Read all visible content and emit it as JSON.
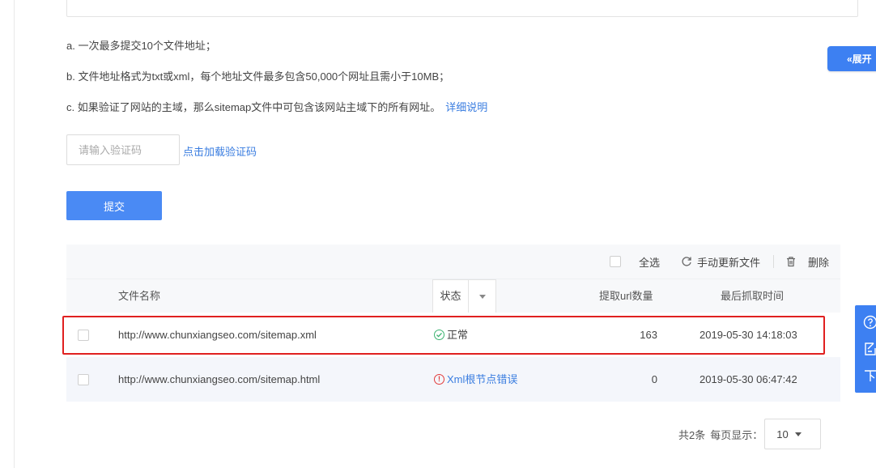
{
  "notes": {
    "a": "a. 一次最多提交10个文件地址；",
    "b": "b. 文件地址格式为txt或xml，每个地址文件最多包含50,000个网址且需小于10MB；",
    "c": "c. 如果验证了网站的主域，那么sitemap文件中可包含该网站主域下的所有网址。",
    "c_link": "详细说明"
  },
  "captcha": {
    "placeholder": "请输入验证码",
    "load_link": "点击加载验证码"
  },
  "submit_label": "提交",
  "toolbar": {
    "select_all": "全选",
    "refresh": "手动更新文件",
    "delete": "删除"
  },
  "table": {
    "headers": {
      "filename": "文件名称",
      "status": "状态",
      "url_count": "提取url数量",
      "last_fetch": "最后抓取时间"
    },
    "rows": [
      {
        "filename": "http://www.chunxiangseo.com/sitemap.xml",
        "status": "正常",
        "status_type": "ok",
        "url_count": "163",
        "last_fetch": "2019-05-30 14:18:03"
      },
      {
        "filename": "http://www.chunxiangseo.com/sitemap.html",
        "status": "Xml根节点错误",
        "status_type": "error",
        "url_count": "0",
        "last_fetch": "2019-05-30 06:47:42"
      }
    ]
  },
  "pager": {
    "total": "共2条",
    "per_page_label": "每页显示：",
    "per_page_value": "10"
  },
  "expand_label": "«展开",
  "colors": {
    "accent": "#4a8af4",
    "link": "#3a7de0",
    "highlight": "#e02020",
    "ok": "#3cb371",
    "error": "#e23c3c"
  },
  "icons": [
    "checkbox",
    "refresh-icon",
    "trash-icon",
    "chevron-down-icon",
    "check-circle-icon",
    "error-circle-icon",
    "help-icon",
    "edit-icon",
    "top-icon"
  ]
}
